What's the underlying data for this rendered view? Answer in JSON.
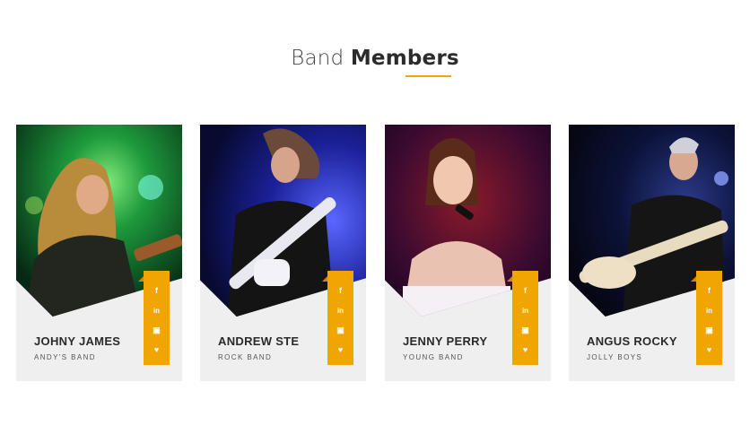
{
  "section": {
    "title_light": "Band",
    "title_bold": "Members"
  },
  "colors": {
    "accent": "#f0a500",
    "card_bg": "#efefef",
    "heading": "#2b2b2b"
  },
  "icons": {
    "facebook": "f",
    "linkedin": "in",
    "youtube": "▣",
    "twitter": "♥"
  },
  "members": [
    {
      "name": "JOHNY JAMES",
      "band": "ANDY'S BAND"
    },
    {
      "name": "ANDREW STE",
      "band": "ROCK BAND"
    },
    {
      "name": "JENNY PERRY",
      "band": "YOUNG BAND"
    },
    {
      "name": "ANGUS ROCKY",
      "band": "JOLLY BOYS"
    }
  ]
}
